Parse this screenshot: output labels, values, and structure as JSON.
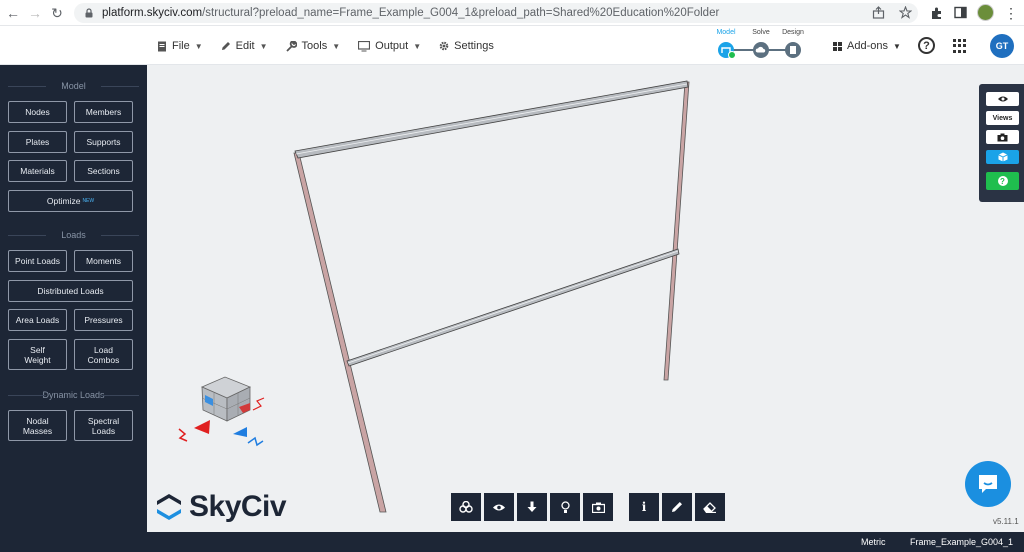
{
  "browser": {
    "url_host": "platform.skyciv.com",
    "url_path": "/structural?preload_name=Frame_Example_G004_1&preload_path=Shared%20Education%20Folder"
  },
  "menu": {
    "file": "File",
    "edit": "Edit",
    "tools": "Tools",
    "output": "Output",
    "settings": "Settings"
  },
  "workflow": {
    "model": "Model",
    "solve": "Solve",
    "design": "Design"
  },
  "header": {
    "addons": "Add-ons",
    "help": "?",
    "avatar": "GT"
  },
  "sidebar": {
    "model_title": "Model",
    "nodes": "Nodes",
    "members": "Members",
    "plates": "Plates",
    "supports": "Supports",
    "materials": "Materials",
    "sections": "Sections",
    "optimize": "Optimize",
    "optimize_badge": "NEW",
    "loads_title": "Loads",
    "point_loads": "Point Loads",
    "moments": "Moments",
    "distributed_loads": "Distributed Loads",
    "area_loads": "Area Loads",
    "pressures": "Pressures",
    "self_weight_1": "Self",
    "self_weight_2": "Weight",
    "load_combos_1": "Load",
    "load_combos_2": "Combos",
    "dynamic_title": "Dynamic Loads",
    "nodal_masses_1": "Nodal",
    "nodal_masses_2": "Masses",
    "spectral_loads_1": "Spectral",
    "spectral_loads_2": "Loads"
  },
  "right_toolbar": {
    "views": "Views",
    "help": "?"
  },
  "bottom_toolbar": {
    "info": "i"
  },
  "logo": {
    "text": "SkyCiv"
  },
  "status": {
    "units": "Metric",
    "file": "Frame_Example_G004_1",
    "version": "v5.11.1"
  },
  "colors": {
    "sidebar_bg": "#1d2636",
    "accent_blue": "#1aa3e8",
    "accent_green": "#1fbe4e",
    "canvas_bg": "#eef0f2",
    "column_color": "#c9a4a4",
    "beam_color": "#7d8288"
  }
}
